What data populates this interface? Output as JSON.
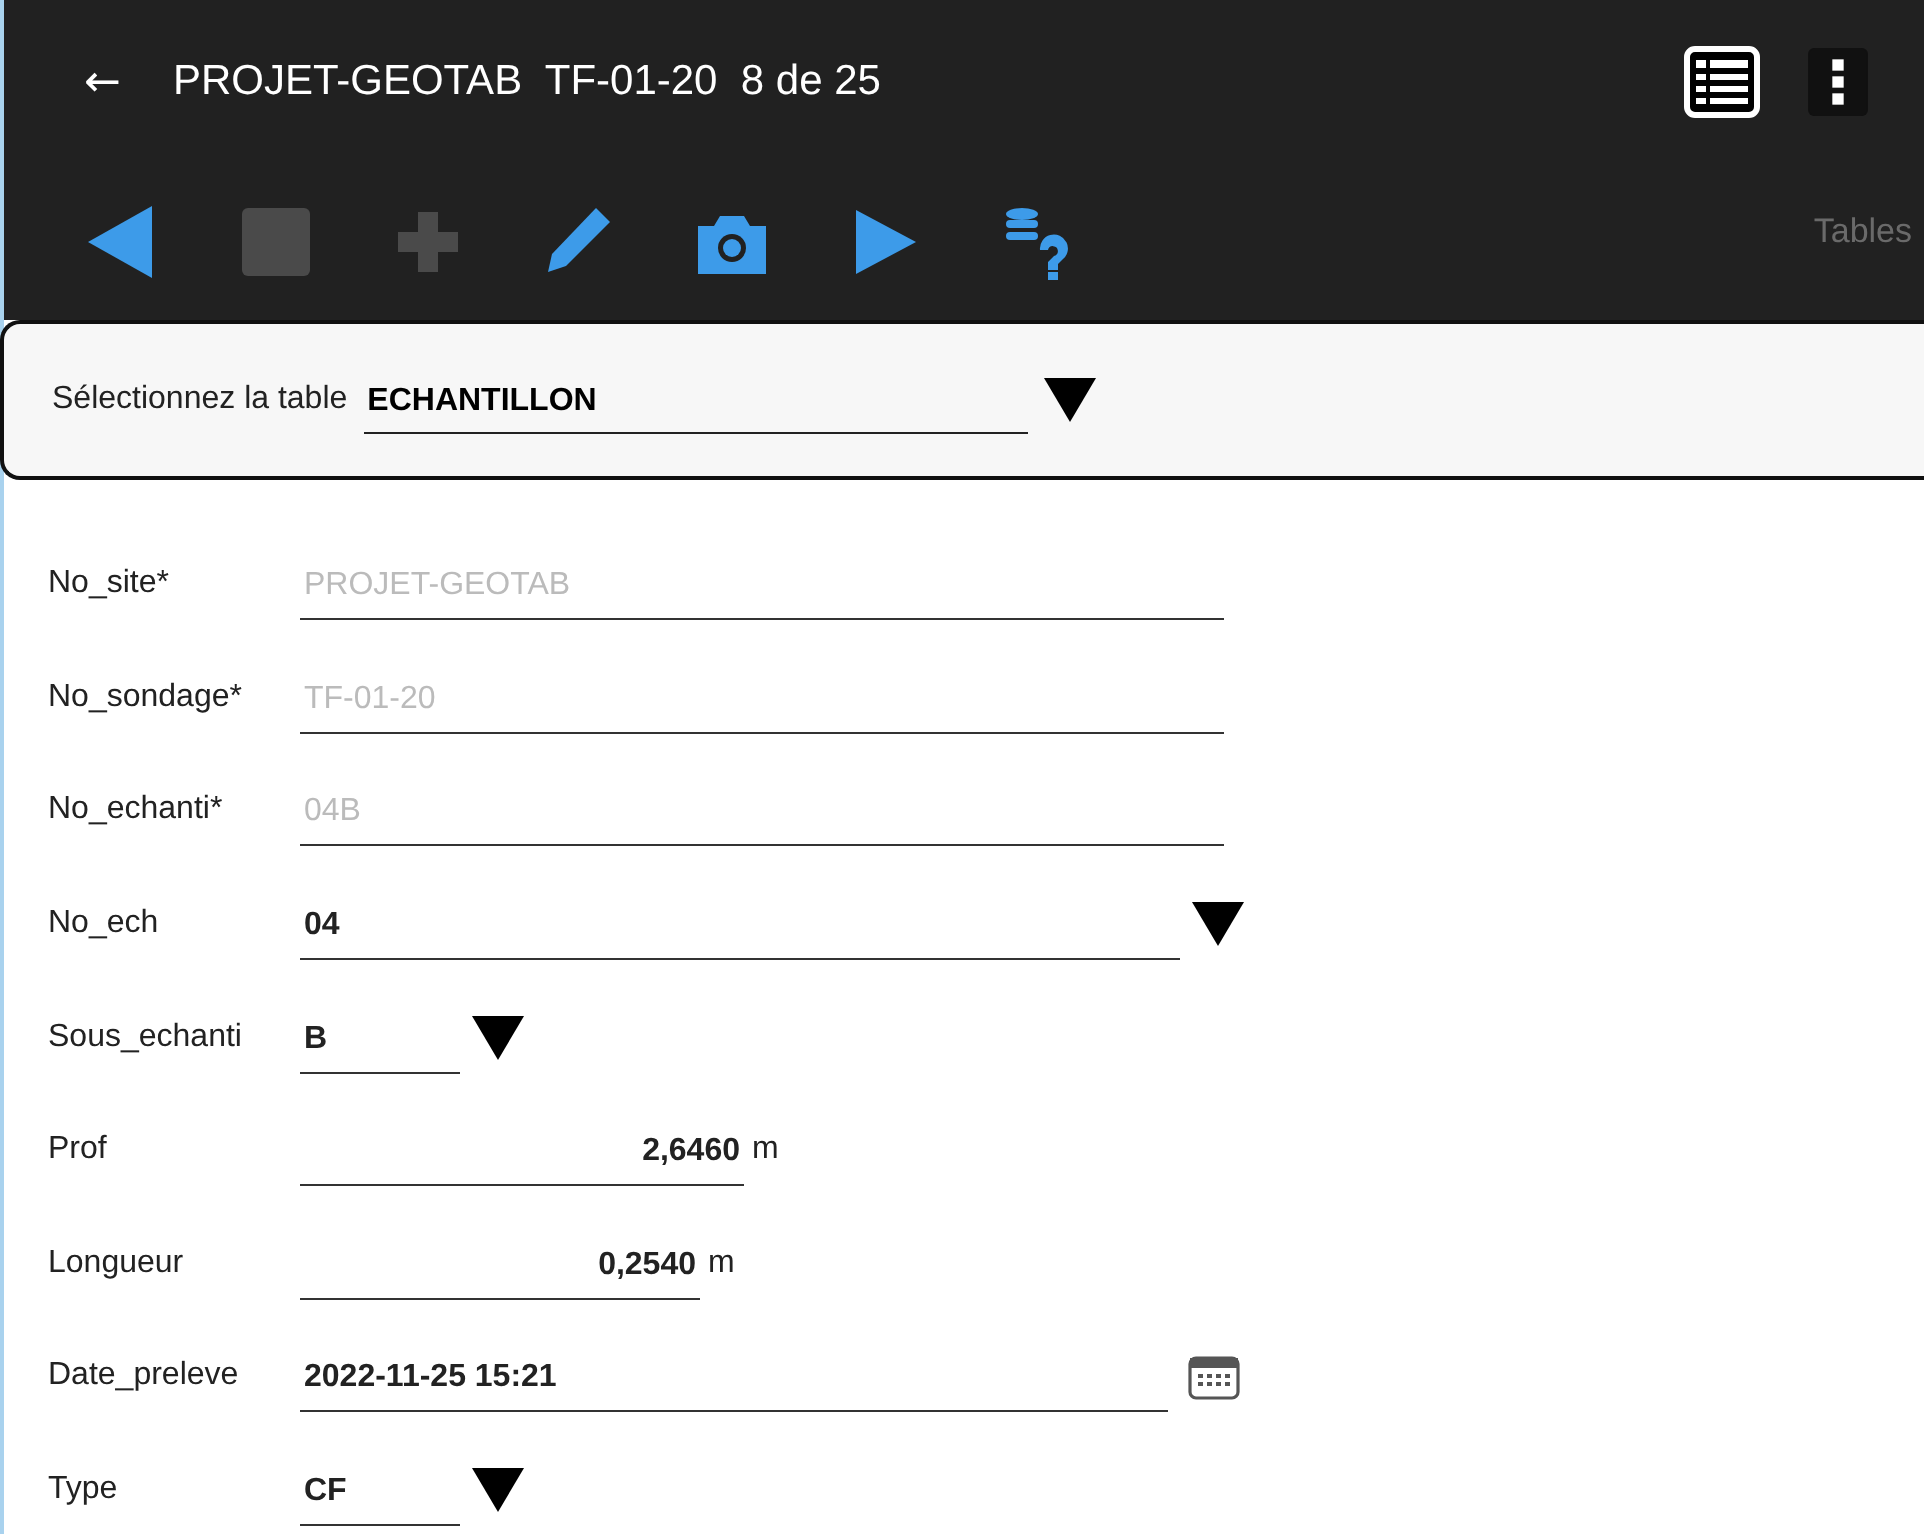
{
  "app_bar": {
    "back": "←",
    "title": "PROJET-GEOTAB  TF-01-20  8 de 25"
  },
  "toolbar": {
    "buttons": [
      {
        "kind": "prev",
        "disabled": false
      },
      {
        "kind": "save",
        "disabled": true
      },
      {
        "kind": "add",
        "disabled": true
      },
      {
        "kind": "edit",
        "disabled": false
      },
      {
        "kind": "camera",
        "disabled": false
      },
      {
        "kind": "next",
        "disabled": false
      },
      {
        "kind": "query",
        "disabled": false
      }
    ],
    "tables_label": "Tables"
  },
  "table_select": {
    "label": "Sélectionnez la table",
    "value": "ECHANTILLON"
  },
  "fields": [
    {
      "kind": "readonly",
      "label": "No_site*",
      "value": "PROJET-GEOTAB"
    },
    {
      "kind": "readonly",
      "label": "No_sondage*",
      "value": "TF-01-20"
    },
    {
      "kind": "readonly",
      "label": "No_echanti*",
      "value": "04B"
    },
    {
      "kind": "dropdown",
      "label": "No_ech",
      "value": "04"
    },
    {
      "kind": "selector",
      "label": "Sous_echanti",
      "value": "B"
    },
    {
      "kind": "number",
      "label": "Prof",
      "value": "2,6460",
      "unit": "m"
    },
    {
      "kind": "number",
      "label": "Longueur",
      "value": "0,2540",
      "unit": "m"
    },
    {
      "kind": "date",
      "label": "Date_preleve",
      "value": "2022-11-25 15:21"
    },
    {
      "kind": "selector",
      "label": "Type",
      "value": "CF"
    }
  ]
}
